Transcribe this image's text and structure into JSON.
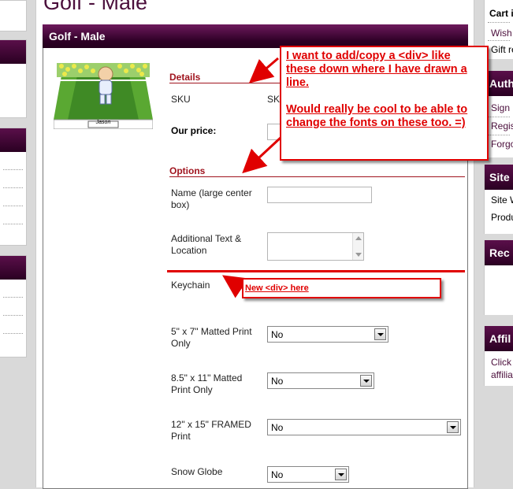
{
  "page": {
    "title": "Golf - Male"
  },
  "product": {
    "bar_title": "Golf - Male",
    "image_name": "Jason"
  },
  "details": {
    "heading": "Details",
    "sku_label": "SKU",
    "sku_value": "SK",
    "price_label": "Our price:"
  },
  "options": {
    "heading": "Options",
    "name_label": "Name (large center box)",
    "name_value": "",
    "additional_label": "Additional Text & Location",
    "keychain_label": "Keychain",
    "matted57_label": "5\" x 7\" Matted Print Only",
    "matted57_value": "No",
    "matted85_label": "8.5\" x 11\" Matted Print Only",
    "matted85_value": "No",
    "framed_label": "12\" x 15\" FRAMED Print",
    "framed_value": "No",
    "globe_label": "Snow Globe",
    "globe_value": "No"
  },
  "annotations": {
    "main_text": "I want to add/copy a <div> like these down where I have drawn a line.",
    "main_text2": "Would really be cool to be able to change the fonts on these too. =)",
    "new_div_text": "New <div> here",
    "color": "#e00000"
  },
  "right_sidebar": {
    "cart_label": "Cart i",
    "wish_link": "Wish",
    "gift_link": "Gift re",
    "auth_heading": "Auth",
    "sign_link": "Sign",
    "register_link": "Regis",
    "forgot_link": "Forgo",
    "site_heading": "Site",
    "site_link1": "Site W",
    "site_link2": "Produ",
    "rec_heading": "Rec",
    "affil_heading": "Affil",
    "affil_text1": "Click",
    "affil_text2": "affilia"
  },
  "colors": {
    "brand": "#4b0f3c",
    "section": "#a0141e"
  }
}
